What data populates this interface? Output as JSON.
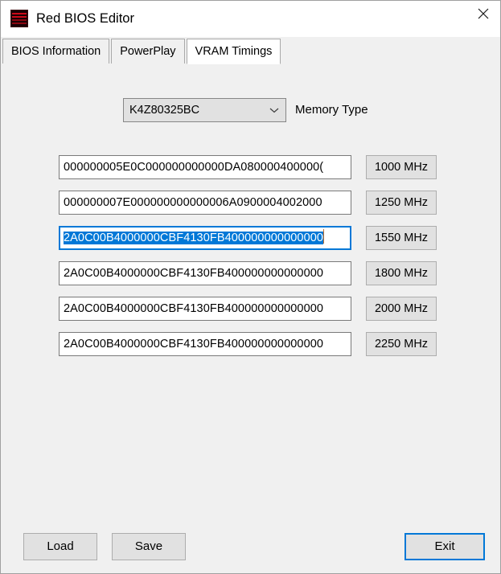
{
  "window": {
    "title": "Red BIOS Editor",
    "icon": "red-bios-editor-logo",
    "close_label": "✕"
  },
  "tabs": [
    {
      "label": "BIOS Information",
      "active": false
    },
    {
      "label": "PowerPlay",
      "active": false
    },
    {
      "label": "VRAM Timings",
      "active": true
    }
  ],
  "memory_type": {
    "selected": "K4Z80325BC",
    "label": "Memory Type",
    "chevron_icon": "chevron-down-icon"
  },
  "timings": [
    {
      "value": "000000005E0C000000000000DA080000400000(",
      "frequency": "1000 MHz",
      "focused": false
    },
    {
      "value": "000000007E000000000000006A0900004002000",
      "frequency": "1250 MHz",
      "focused": false
    },
    {
      "value": "2A0C00B4000000CBF4130FB400000000000000",
      "frequency": "1550 MHz",
      "focused": true
    },
    {
      "value": "2A0C00B4000000CBF4130FB400000000000000",
      "frequency": "1800 MHz",
      "focused": false
    },
    {
      "value": "2A0C00B4000000CBF4130FB400000000000000",
      "frequency": "2000 MHz",
      "focused": false
    },
    {
      "value": "2A0C00B4000000CBF4130FB400000000000000",
      "frequency": "2250 MHz",
      "focused": false
    }
  ],
  "actions": {
    "load": "Load",
    "save": "Save",
    "exit": "Exit"
  },
  "colors": {
    "window_background": "#f0f0f0",
    "titlebar_background": "#ffffff",
    "accent_focus": "#0078d7",
    "button_face": "#e1e1e1",
    "logo_red": "#cc0a18"
  }
}
